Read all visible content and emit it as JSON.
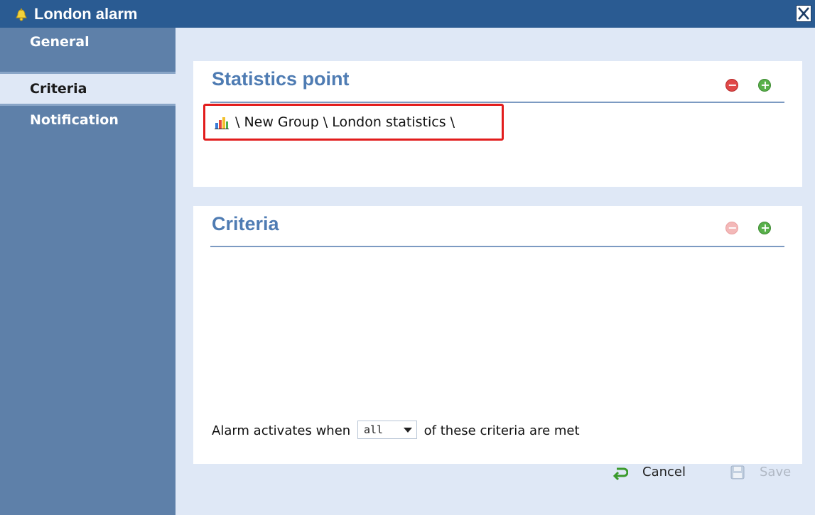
{
  "window": {
    "title": "London alarm",
    "close_symbol": "X"
  },
  "sidebar": {
    "items": [
      {
        "label": "General",
        "selected": false
      },
      {
        "label": "Criteria",
        "selected": true
      },
      {
        "label": "Notification",
        "selected": false
      }
    ]
  },
  "statistics_panel": {
    "title": "Statistics point",
    "path": "\\ New Group \\ London statistics \\",
    "path_icon": "statistics-chart-icon"
  },
  "criteria_panel": {
    "title": "Criteria",
    "alarm_prefix": "Alarm activates when",
    "match_value": "all",
    "alarm_suffix": "of these criteria are met"
  },
  "footer": {
    "cancel_label": "Cancel",
    "save_label": "Save"
  },
  "colors": {
    "titlebar": "#2a5b92",
    "sidebar": "#5e80a9",
    "content_bg": "#dfe8f6",
    "panel_title": "#4f7cb3",
    "highlight_box": "#e21d1d",
    "remove": "#e04848",
    "add": "#58b04a"
  }
}
